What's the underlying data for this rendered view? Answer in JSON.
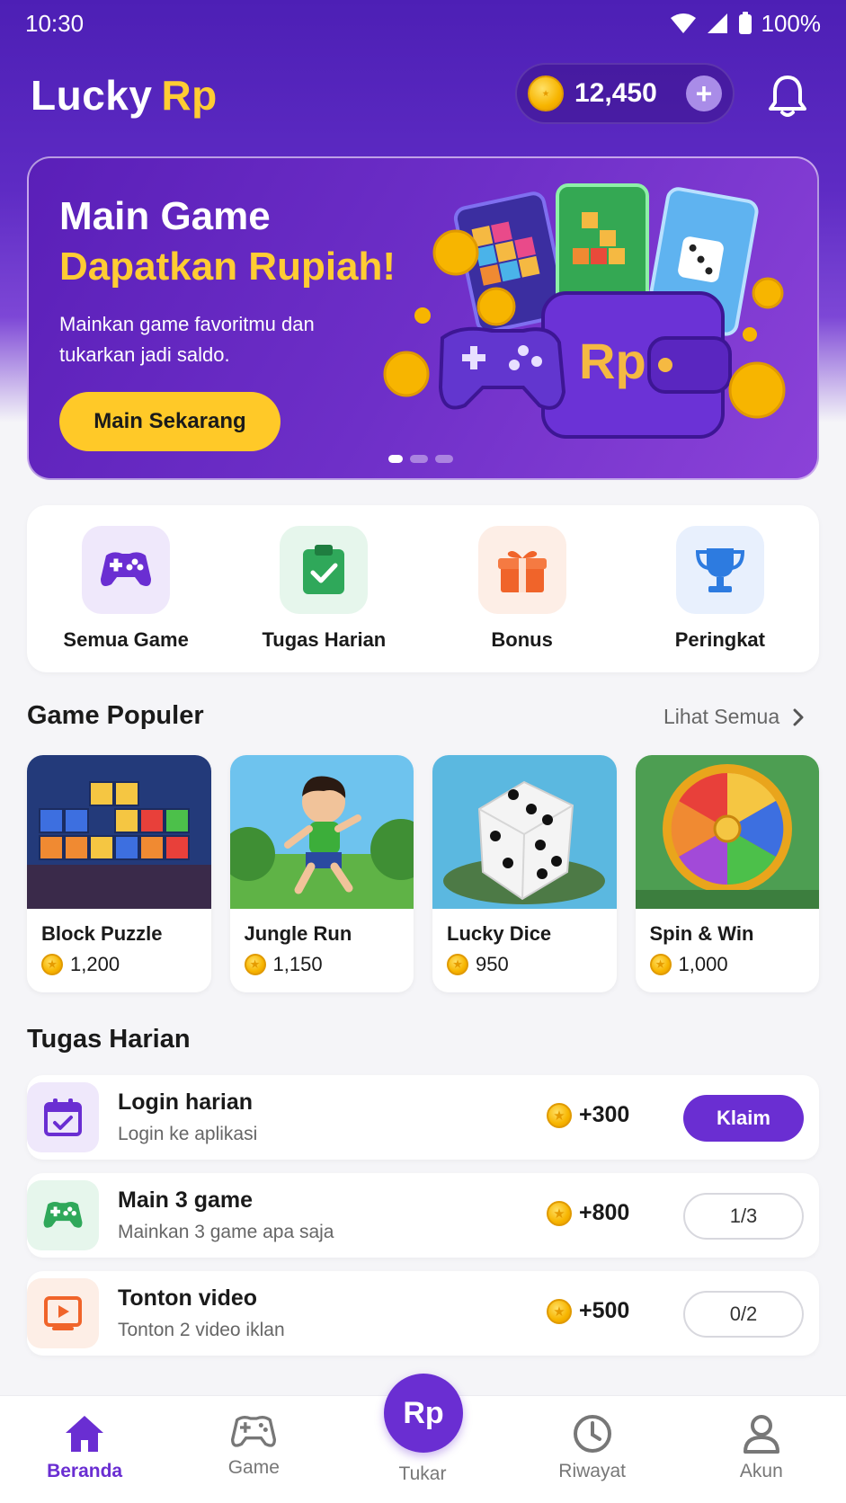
{
  "status_bar": {
    "time": "10:30",
    "battery": "100%"
  },
  "header": {
    "brand_main": "Lucky",
    "brand_accent": "Rp",
    "coin_balance": "12,450",
    "plus_symbol": "+"
  },
  "banner": {
    "title_line1": "Main Game",
    "title_line2": "Dapatkan Rupiah!",
    "description": "Mainkan game favoritmu dan tukarkan jadi saldo.",
    "cta_label": "Main Sekarang",
    "wallet_text": "Rp",
    "active_slide": 1,
    "slide_count": 3
  },
  "quick_menu": [
    {
      "label": "Semua Game",
      "icon": "gamepad-icon",
      "bg": "#efe8fb",
      "color": "#6a2ed2"
    },
    {
      "label": "Tugas Harian",
      "icon": "clipboard-check-icon",
      "bg": "#e6f6ec",
      "color": "#2fa85a"
    },
    {
      "label": "Bonus",
      "icon": "gift-icon",
      "bg": "#fdeee6",
      "color": "#f0642a"
    },
    {
      "label": "Peringkat",
      "icon": "trophy-icon",
      "bg": "#e8f0fd",
      "color": "#2d7be0"
    }
  ],
  "popular": {
    "title": "Game Populer",
    "see_all": "Lihat Semua",
    "games": [
      {
        "name": "Block Puzzle",
        "points": "1,200"
      },
      {
        "name": "Jungle Run",
        "points": "1,150"
      },
      {
        "name": "Lucky Dice",
        "points": "950"
      },
      {
        "name": "Spin & Win",
        "points": "1,000"
      }
    ]
  },
  "daily": {
    "title": "Tugas Harian",
    "tasks": [
      {
        "title": "Login harian",
        "subtitle": "Login ke aplikasi",
        "reward": "+300",
        "action": "Klaim",
        "icon": "calendar-check-icon"
      },
      {
        "title": "Main 3 game",
        "subtitle": "Mainkan 3 game apa saja",
        "reward": "+800",
        "action": "1/3",
        "icon": "gamepad-icon"
      },
      {
        "title": "Tonton video",
        "subtitle": "Tonton 2 video iklan",
        "reward": "+500",
        "action": "0/2",
        "icon": "play-video-icon"
      }
    ]
  },
  "nav": {
    "items": [
      {
        "label": "Beranda",
        "icon": "home-icon",
        "active": true
      },
      {
        "label": "Game",
        "icon": "gamepad-icon",
        "active": false
      },
      {
        "label": "Tukar",
        "icon": "rp-exchange-icon",
        "active": false
      },
      {
        "label": "Riwayat",
        "icon": "clock-icon",
        "active": false
      },
      {
        "label": "Akun",
        "icon": "user-icon",
        "active": false
      }
    ],
    "center_text": "Rp"
  },
  "colors": {
    "primary": "#6a2ed2",
    "accent_yellow": "#ffc928",
    "coin": "#f7b500"
  }
}
